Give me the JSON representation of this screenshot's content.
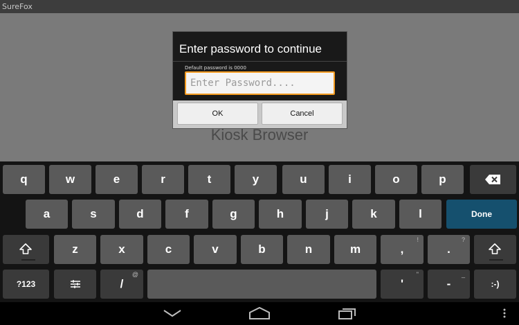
{
  "window": {
    "title": "SureFox"
  },
  "background": {
    "text": "Kiosk Browser"
  },
  "dialog": {
    "title": "Enter password to continue",
    "hint": "Default password is 0000",
    "placeholder": "Enter Password....",
    "ok_label": "OK",
    "cancel_label": "Cancel",
    "accent_color": "#f39a1f"
  },
  "keyboard": {
    "row1": [
      "q",
      "w",
      "e",
      "r",
      "t",
      "y",
      "u",
      "i",
      "o",
      "p"
    ],
    "row2": [
      "a",
      "s",
      "d",
      "f",
      "g",
      "h",
      "j",
      "k",
      "l"
    ],
    "row3": [
      "z",
      "x",
      "c",
      "v",
      "b",
      "n",
      "m",
      ","
    ],
    "row3_period": ".",
    "hints": {
      "comma": "!",
      "period": "?",
      "slash": "@",
      "apostrophe": "\"",
      "dash": "_"
    },
    "done_label": "Done",
    "done_color": "#15506e",
    "symbols_label": "?123",
    "slash_label": "/",
    "apostrophe_label": "'",
    "dash_label": "-",
    "smiley_label": ":-)",
    "icons": [
      "backspace-icon",
      "shift-icon",
      "settings-icon"
    ]
  },
  "navbar": {
    "icons": [
      "back-icon",
      "home-icon",
      "recent-apps-icon",
      "menu-icon"
    ]
  }
}
